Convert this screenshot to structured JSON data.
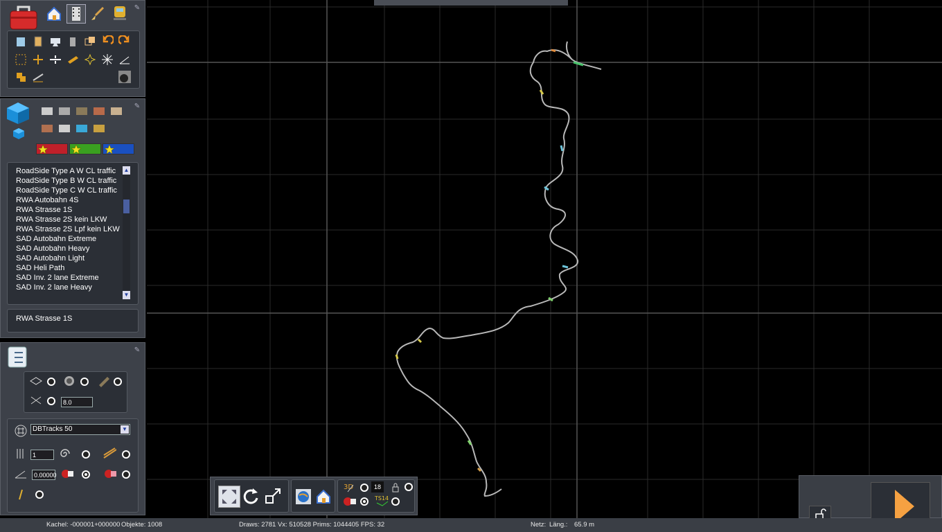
{
  "toolbox": {
    "top_icons": [
      "toolbox-icon",
      "home-icon",
      "film-icon",
      "brush-icon",
      "train-icon"
    ],
    "tools_row1": [
      "book-icon",
      "clipboard-icon",
      "monitor-icon",
      "trash-icon",
      "copy-icon",
      "undo-icon",
      "redo-icon"
    ],
    "tools_row2": [
      "select-box-icon",
      "move-icon",
      "split-icon",
      "ruler-icon",
      "sparkle-icon",
      "star-burst-icon",
      "angle-icon"
    ],
    "tools_row3": [
      "paint-icon",
      "pencil-icon",
      "bomb-icon"
    ]
  },
  "object_browser": {
    "category_icons": [
      "rails-icon",
      "tracks-icon",
      "track-bed-icon",
      "bricks-icon",
      "slab-icon",
      "bridge-icon",
      "road-icon",
      "water-icon",
      "bag-icon"
    ],
    "star_buttons": [
      "star-red-button",
      "star-green-button",
      "star-blue-button"
    ],
    "items": [
      "RoadSide Type A W CL traffic",
      "RoadSide Type B W CL traffic",
      "RoadSide Type C W CL traffic",
      "RWA Autobahn 4S",
      "RWA Strasse 1S",
      "RWA Strasse 2S kein LKW",
      "RWA Strasse 2S Lpf kein LKW",
      "SAD Autobahn Extreme",
      "SAD Autobahn Heavy",
      "SAD Autobahn Light",
      "SAD Heli Path",
      "SAD Inv. 2 lane Extreme",
      "SAD Inv. 2 lane Heavy"
    ],
    "selected": "RWA Strasse 1S"
  },
  "properties": {
    "height_value": "8.0",
    "track_type": "DBTracks 50",
    "count_value": "1",
    "angle_value": "0.00000"
  },
  "bottom_toolbar": {
    "counter_value": "18"
  },
  "status": {
    "kachel": "Kachel: -000001+000000",
    "objekte": "Objekte: 1008",
    "draws": "Draws: 2781 Vx: 510528 Prims: 1044405 FPS: 32",
    "netz": "Netz:",
    "laeng": "Läng.:",
    "length": "65.9 m"
  },
  "colors": {
    "panel": "#3a3e45",
    "grid": "#2e2e2e",
    "track": "#b8b8b8",
    "play": "#f5a142"
  }
}
